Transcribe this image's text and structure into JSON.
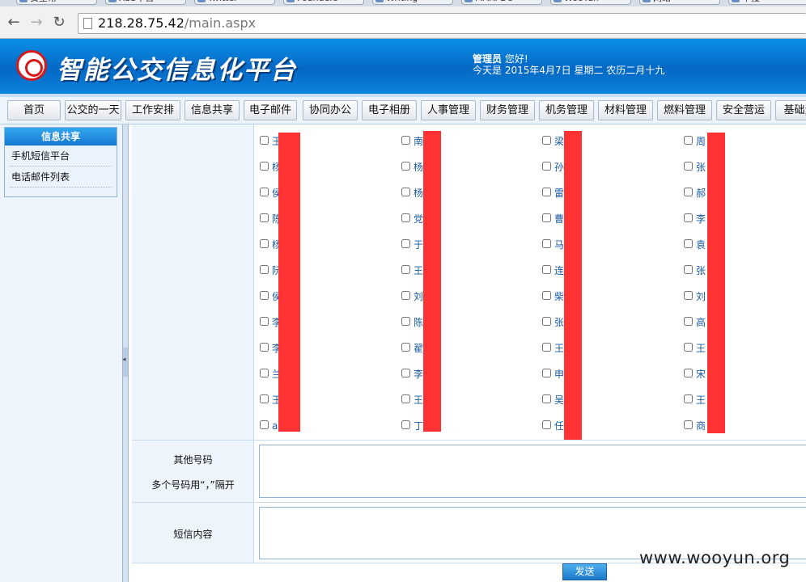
{
  "browser": {
    "tabs": [
      {
        "label": "安全帮"
      },
      {
        "label": "XSS平台"
      },
      {
        "label": "Twitter"
      },
      {
        "label": "Founders"
      },
      {
        "label": "Writing"
      },
      {
        "label": "MAR. De"
      },
      {
        "label": "WooYun"
      },
      {
        "label": "网络"
      },
      {
        "label": "中搜"
      }
    ],
    "url_host": "218.28.75.42",
    "url_path": "/main.aspx"
  },
  "header": {
    "title": "智能公交信息化平台",
    "user_role": "管理员",
    "greeting": "您好!",
    "date_line": "今天是  2015年4月7日  星期二  农历二月十九"
  },
  "menu": [
    "首页",
    "公交的一天",
    "工作安排",
    "信息共享",
    "电子邮件",
    "协同办公",
    "电子相册",
    "人事管理",
    "财务管理",
    "机务管理",
    "材料管理",
    "燃料管理",
    "安全营运",
    "基础资"
  ],
  "sidebar": {
    "title": "信息共享",
    "links": [
      "手机短信平台",
      "电话邮件列表"
    ]
  },
  "recipients": {
    "columns": [
      [
        "王",
        "杨",
        "侯",
        "陈",
        "杨",
        "阮",
        "侯",
        "李",
        "李",
        "兰",
        "王",
        "au"
      ],
      [
        "南",
        "杨",
        "杨",
        "党",
        "于",
        "王",
        "刘",
        "陈",
        "翟",
        "李",
        "王",
        "丁"
      ],
      [
        "梁",
        "孙",
        "雷",
        "曹",
        "马",
        "连",
        "柴",
        "张",
        "王",
        "申",
        "吴",
        "任"
      ],
      [
        "周",
        "张",
        "郝",
        "李",
        "袁",
        "张",
        "刘",
        "高",
        "王",
        "宋",
        "王",
        "商"
      ]
    ]
  },
  "form": {
    "other_numbers_label": "其他号码",
    "other_numbers_hint": "多个号码用“，”隔开",
    "sms_content_label": "短信内容",
    "send_label": "发送"
  },
  "watermark": "www.wooyun.org"
}
